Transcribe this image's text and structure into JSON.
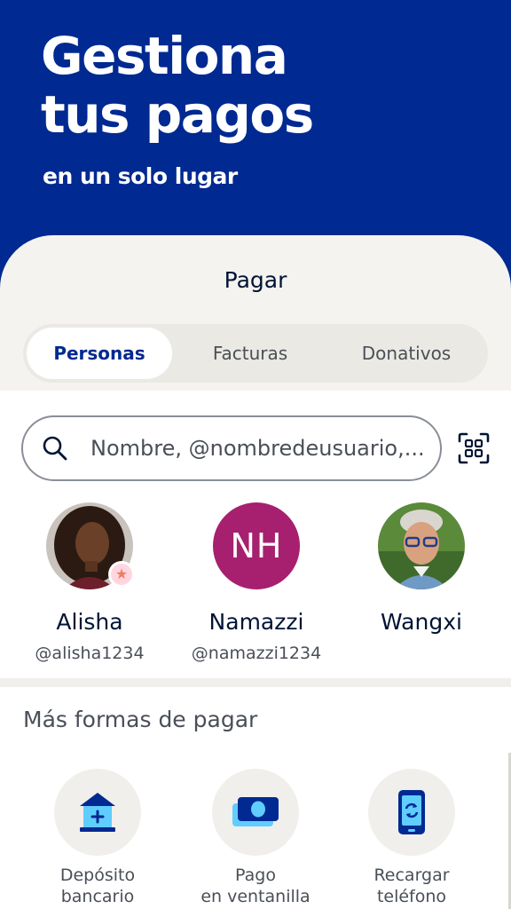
{
  "hero": {
    "title_line1": "Gestiona",
    "title_line2": "tus pagos",
    "subtitle": "en un solo lugar"
  },
  "sheet": {
    "title": "Pagar",
    "tabs": [
      {
        "label": "Personas",
        "active": true
      },
      {
        "label": "Facturas",
        "active": false
      },
      {
        "label": "Donativos",
        "active": false
      }
    ]
  },
  "search": {
    "placeholder": "Nombre, @nombredeusuario,..."
  },
  "contacts": [
    {
      "name": "Alisha",
      "handle": "@alisha1234",
      "favorite": true,
      "avatar": "photo"
    },
    {
      "name": "Namazzi",
      "handle": "@namazzi1234",
      "initials": "NH",
      "avatar": "initials"
    },
    {
      "name": "Wangxi",
      "handle": "",
      "avatar": "photo"
    }
  ],
  "more": {
    "title": "Más formas de pagar",
    "items": [
      {
        "line1": "Depósito",
        "line2": "bancario",
        "icon": "bank-icon"
      },
      {
        "line1": "Pago",
        "line2": "en ventanilla",
        "icon": "cash-icon"
      },
      {
        "line1": "Recargar",
        "line2": "teléfono",
        "icon": "phone-reload-icon"
      }
    ]
  },
  "colors": {
    "brand": "#002991",
    "accent_magenta": "#a6206f",
    "sheet_bg": "#f5f3ef"
  }
}
